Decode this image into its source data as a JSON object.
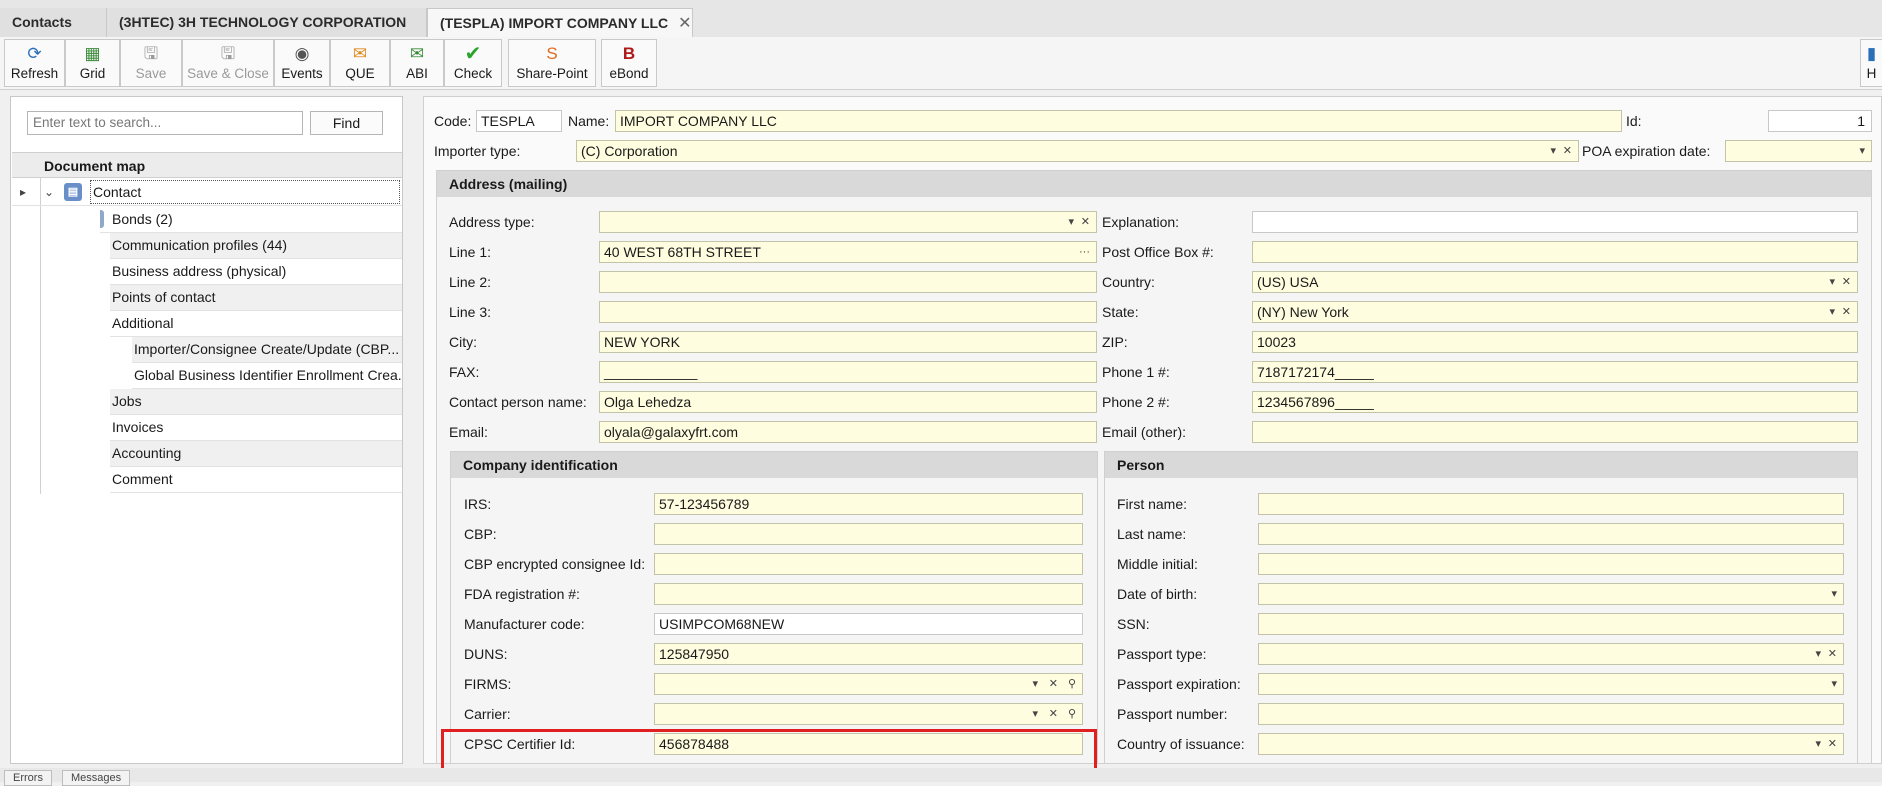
{
  "tabs": [
    {
      "label": "Contacts"
    },
    {
      "label": "(3HTEC) 3H TECHNOLOGY CORPORATION"
    },
    {
      "label": "(TESPLA) IMPORT COMPANY LLC"
    }
  ],
  "toolbar": {
    "refresh": "Refresh",
    "grid": "Grid",
    "save": "Save",
    "save_close": "Save & Close",
    "events": "Events",
    "que": "QUE",
    "abi": "ABI",
    "check": "Check",
    "share_point": "Share-Point",
    "ebond": "eBond",
    "right_partial": "H"
  },
  "search": {
    "placeholder": "Enter text to search...",
    "find": "Find"
  },
  "document_map": {
    "title": "Document map",
    "items": [
      {
        "label": "Contact"
      },
      {
        "label": "Bonds (2)"
      },
      {
        "label": "Communication profiles (44)"
      },
      {
        "label": "Business address (physical)"
      },
      {
        "label": "Points of contact"
      },
      {
        "label": "Additional"
      },
      {
        "label": "Importer/Consignee Create/Update (CBP..."
      },
      {
        "label": "Global Business Identifier Enrollment Crea..."
      },
      {
        "label": "Jobs"
      },
      {
        "label": "Invoices"
      },
      {
        "label": "Accounting"
      },
      {
        "label": "Comment"
      }
    ]
  },
  "header": {
    "code_label": "Code:",
    "code": "TESPLA",
    "name_label": "Name:",
    "name": "IMPORT COMPANY LLC",
    "id_label": "Id:",
    "id": "1",
    "importer_type_label": "Importer type:",
    "importer_type": "(C) Corporation",
    "poa_label": "POA expiration date:",
    "poa": ""
  },
  "address": {
    "title": "Address (mailing)",
    "address_type_label": "Address type:",
    "address_type": "",
    "explanation_label": "Explanation:",
    "explanation": "",
    "line1_label": "Line 1:",
    "line1": "40 WEST 68TH STREET",
    "pobox_label": "Post Office Box #:",
    "pobox": "",
    "line2_label": "Line 2:",
    "line2": "",
    "country_label": "Country:",
    "country": "(US) USA",
    "line3_label": "Line 3:",
    "line3": "",
    "state_label": "State:",
    "state": "(NY) New York",
    "city_label": "City:",
    "city": "NEW YORK",
    "zip_label": "ZIP:",
    "zip": "10023",
    "fax_label": "FAX:",
    "fax": "____________",
    "phone1_label": "Phone 1 #:",
    "phone1": "7187172174_____",
    "contact_label": "Contact person name:",
    "contact": "Olga Lehedza",
    "phone2_label": "Phone 2 #:",
    "phone2": "1234567896_____",
    "email_label": "Email:",
    "email": "olyala@galaxyfrt.com",
    "email_other_label": "Email (other):",
    "email_other": ""
  },
  "company": {
    "title": "Company identification",
    "irs_label": "IRS:",
    "irs": "57-123456789",
    "cbp_label": "CBP:",
    "cbp": "",
    "cbp_enc_label": "CBP encrypted consignee Id:",
    "cbp_enc": "",
    "fda_label": "FDA registration #:",
    "fda": "",
    "mfr_label": "Manufacturer code:",
    "mfr": "USIMPCOM68NEW",
    "duns_label": "DUNS:",
    "duns": "125847950",
    "firms_label": "FIRMS:",
    "firms": "",
    "carrier_label": "Carrier:",
    "carrier": "",
    "cpsc_label": "CPSC Certifier Id:",
    "cpsc": "456878488"
  },
  "person": {
    "title": "Person",
    "first_label": "First name:",
    "first": "",
    "last_label": "Last name:",
    "last": "",
    "middle_label": "Middle initial:",
    "middle": "",
    "dob_label": "Date of birth:",
    "dob": "",
    "ssn_label": "SSN:",
    "ssn": "",
    "ptype_label": "Passport type:",
    "ptype": "",
    "pexp_label": "Passport expiration:",
    "pexp": "",
    "pnum_label": "Passport number:",
    "pnum": "",
    "issuance_label": "Country of issuance:",
    "issuance": ""
  },
  "bottom_tabs": {
    "errors": "Errors",
    "messages": "Messages"
  },
  "colors": {
    "field_bg": "#fffddf",
    "highlight": "#e02020"
  }
}
